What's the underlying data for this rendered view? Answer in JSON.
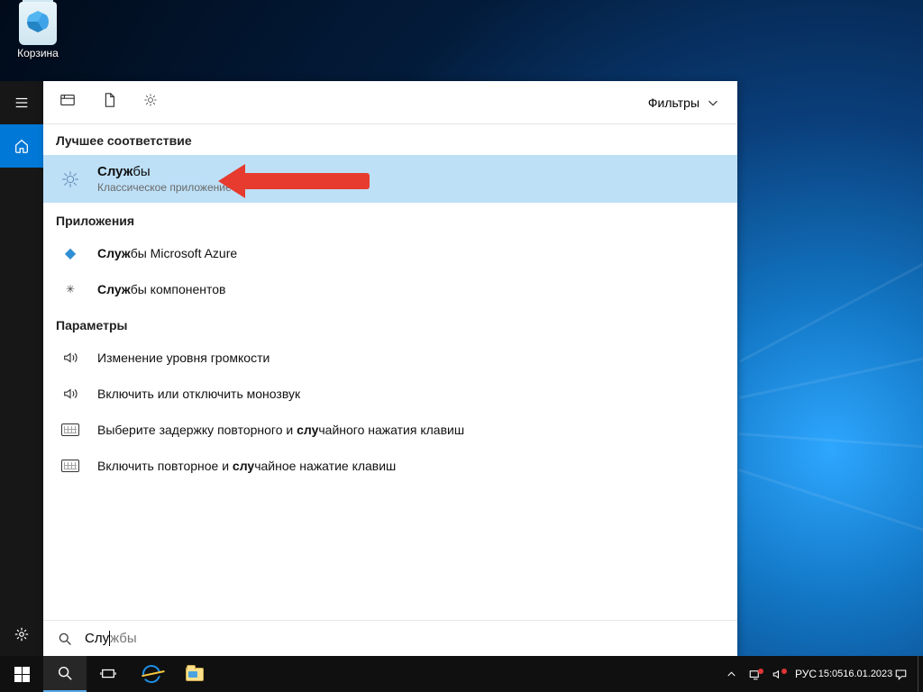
{
  "desktop": {
    "recycle_bin": "Корзина"
  },
  "rail": {
    "hamburger": "menu",
    "home": "home",
    "settings": "settings"
  },
  "tabs": {
    "filters": "Фильтры"
  },
  "sections": {
    "best_match": "Лучшее соответствие",
    "apps": "Приложения",
    "settings": "Параметры"
  },
  "best": {
    "title_bold": "Служ",
    "title_rest": "бы",
    "sub": "Классическое приложение"
  },
  "apps": [
    {
      "bold": "Служ",
      "rest": "бы Microsoft Azure"
    },
    {
      "bold": "Служ",
      "rest": "бы компонентов"
    }
  ],
  "settings": [
    {
      "icon": "speaker",
      "pre": "Изменение уровня громкости",
      "bold": "",
      "post": ""
    },
    {
      "icon": "speaker",
      "pre": "Включить или отключить монозвук",
      "bold": "",
      "post": ""
    },
    {
      "icon": "keyboard",
      "pre": "Выберите задержку повторного и ",
      "bold": "слу",
      "post": "чайного нажатия клавиш"
    },
    {
      "icon": "keyboard",
      "pre": "Включить повторное и ",
      "bold": "слу",
      "post": "чайное нажатие клавиш"
    }
  ],
  "searchbox": {
    "prefix": "Слу",
    "rest": "жбы"
  },
  "tray": {
    "lang": "РУС",
    "time": "15:05",
    "date": "16.01.2023"
  }
}
